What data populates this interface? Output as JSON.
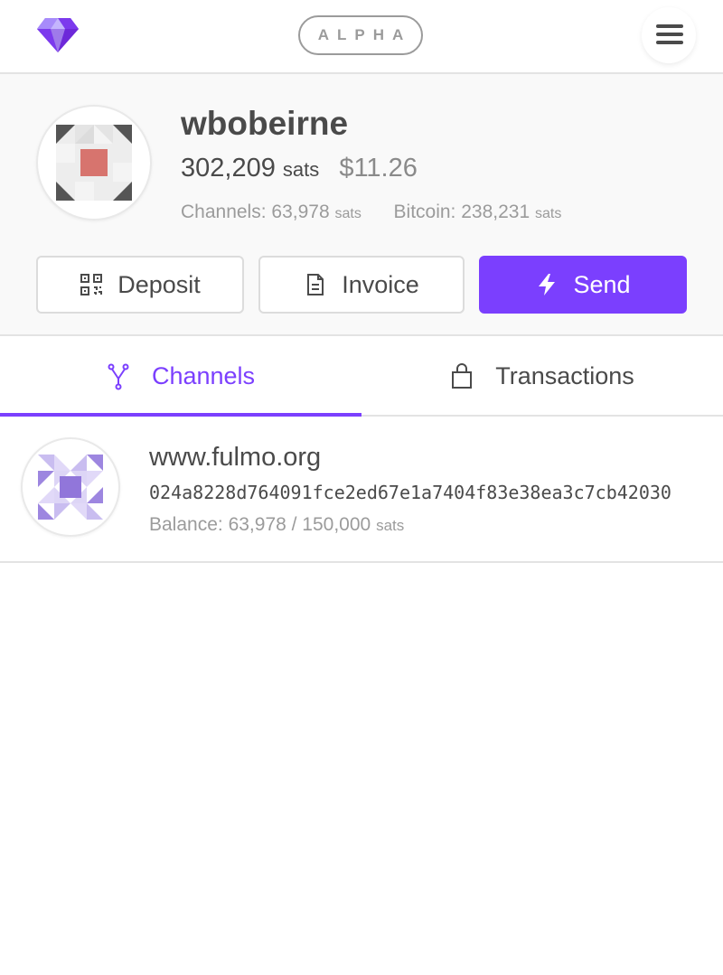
{
  "header": {
    "badge": "ALPHA",
    "logo_icon": "diamond-icon",
    "menu_icon": "hamburger-menu-icon",
    "accent_color": "#7b3ffe"
  },
  "profile": {
    "username": "wbobeirne",
    "balance_sats": "302,209",
    "balance_unit": "sats",
    "balance_fiat": "$11.26",
    "channels_label": "Channels:",
    "channels_value": "63,978",
    "channels_unit": "sats",
    "bitcoin_label": "Bitcoin:",
    "bitcoin_value": "238,231",
    "bitcoin_unit": "sats"
  },
  "actions": {
    "deposit_label": "Deposit",
    "invoice_label": "Invoice",
    "send_label": "Send"
  },
  "tabs": [
    {
      "label": "Channels",
      "icon": "fork-icon",
      "active": true
    },
    {
      "label": "Transactions",
      "icon": "shopping-bag-icon",
      "active": false
    }
  ],
  "channels": [
    {
      "name": "www.fulmo.org",
      "pubkey": "024a8228d764091fce2ed67e1a7404f83e38ea3c7cb42030",
      "balance_label": "Balance:",
      "balance_value": "63,978 / 150,000",
      "balance_unit": "sats"
    }
  ]
}
